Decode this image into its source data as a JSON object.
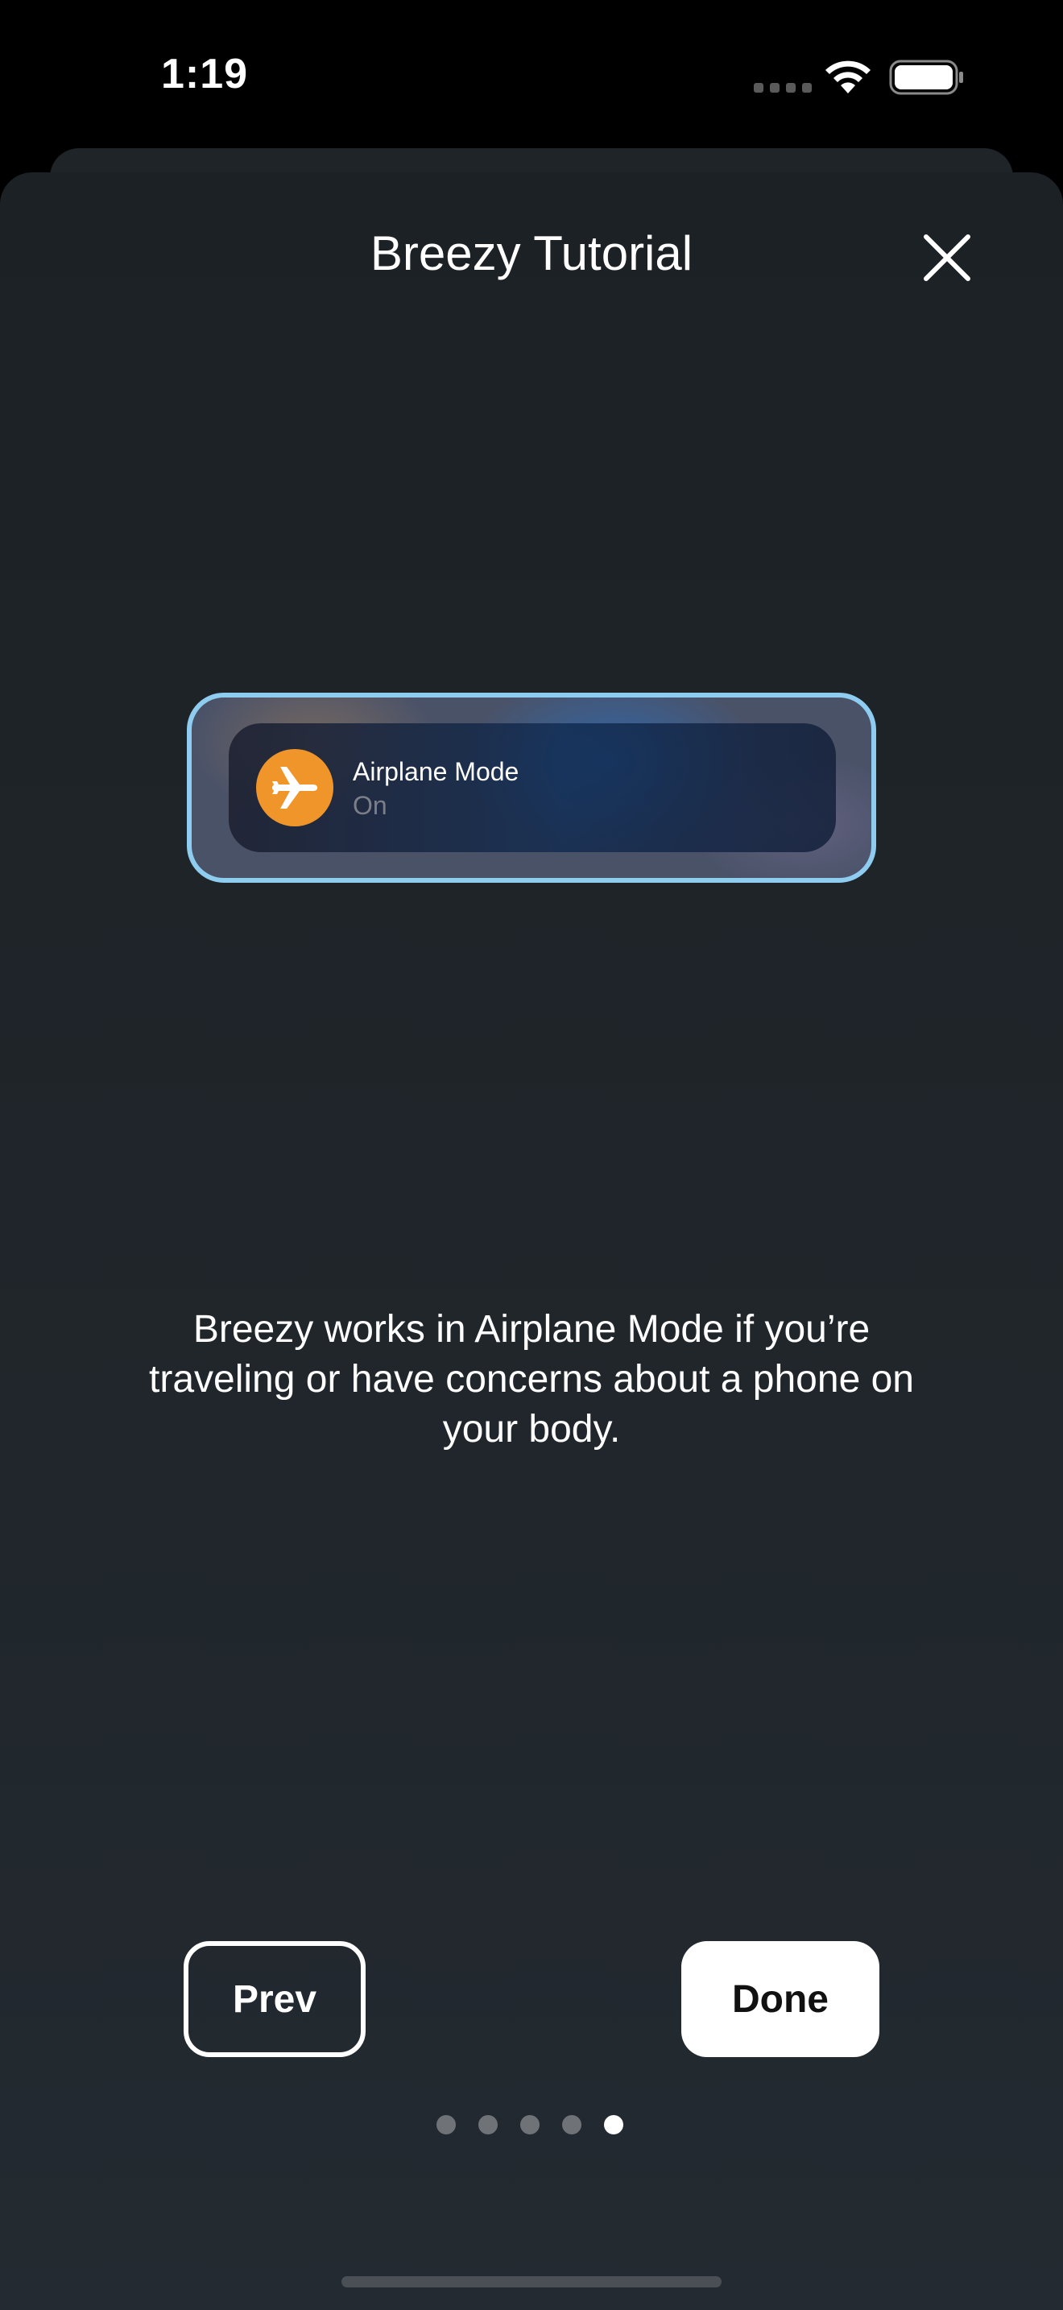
{
  "status_bar": {
    "time": "1:19",
    "icons": [
      "signal-dots-icon",
      "wifi-icon",
      "battery-icon"
    ]
  },
  "header": {
    "title": "Breezy Tutorial",
    "close_icon": "close-icon"
  },
  "airplane_card": {
    "icon": "airplane-icon",
    "title": "Airplane Mode",
    "status": "On",
    "icon_color": "#f09529",
    "border_color": "#8ecdf0"
  },
  "description": "Breezy works in Airplane Mode if you’re traveling or have concerns about a phone on your body.",
  "buttons": {
    "prev_label": "Prev",
    "done_label": "Done"
  },
  "pagination": {
    "total": 5,
    "current": 5
  }
}
